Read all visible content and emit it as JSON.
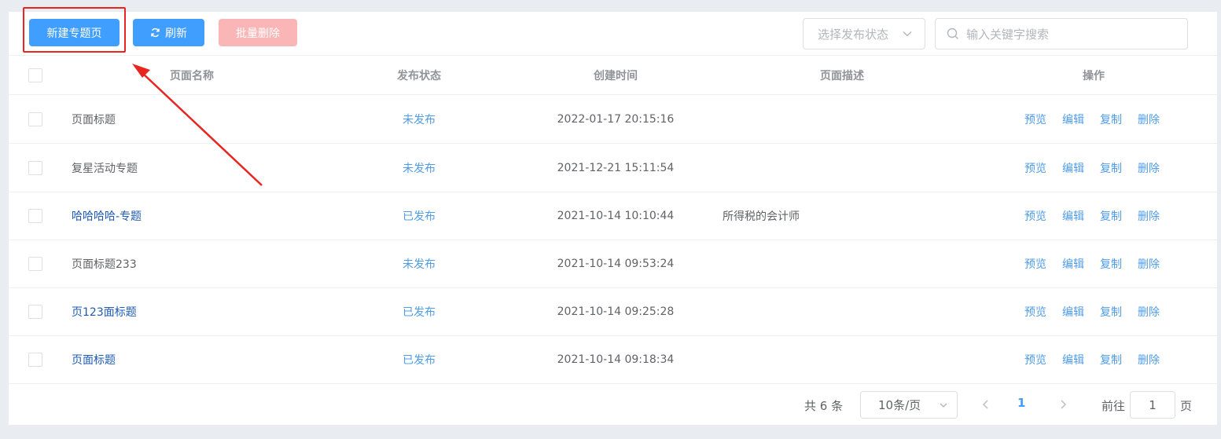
{
  "toolbar": {
    "new_label": "新建专题页",
    "refresh_label": "刷新",
    "batch_delete_label": "批量删除",
    "status_placeholder": "选择发布状态",
    "search_placeholder": "输入关键字搜索"
  },
  "table": {
    "headers": [
      "页面名称",
      "发布状态",
      "创建时间",
      "页面描述",
      "操作"
    ],
    "rows": [
      {
        "name": "页面标题",
        "status": "未发布",
        "created": "2022-01-17 20:15:16",
        "desc": "",
        "name_link": false
      },
      {
        "name": "复星活动专题",
        "status": "未发布",
        "created": "2021-12-21 15:11:54",
        "desc": "",
        "name_link": false
      },
      {
        "name": "哈哈哈哈-专题",
        "status": "已发布",
        "created": "2021-10-14 10:10:44",
        "desc": "所得税的会计师",
        "name_link": true
      },
      {
        "name": "页面标题233",
        "status": "未发布",
        "created": "2021-10-14 09:53:24",
        "desc": "",
        "name_link": false
      },
      {
        "name": "页123面标题",
        "status": "已发布",
        "created": "2021-10-14 09:25:28",
        "desc": "",
        "name_link": true
      },
      {
        "name": "页面标题",
        "status": "已发布",
        "created": "2021-10-14 09:18:34",
        "desc": "",
        "name_link": true
      }
    ],
    "ops": [
      "预览",
      "编辑",
      "复制",
      "删除"
    ]
  },
  "pagination": {
    "total_text": "共 6 条",
    "page_size": "10条/页",
    "current_page": "1",
    "goto_label": "前往",
    "goto_value": "1",
    "page_suffix": "页"
  },
  "colors": {
    "primary": "#409eff",
    "danger_light": "#fab6b6",
    "annotation": "#e8251f"
  }
}
